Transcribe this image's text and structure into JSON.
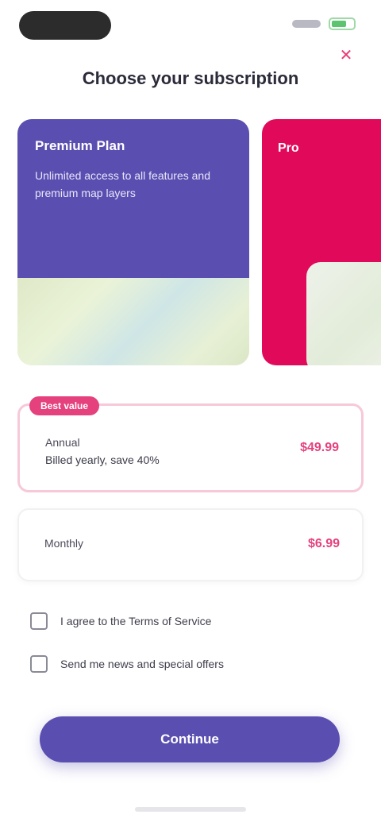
{
  "colors": {
    "primary": "#5a4fb0",
    "accent": "#e5417d",
    "pink_card": "#e1095a"
  },
  "icons": {
    "close": "close-icon",
    "signal": "signal-icon",
    "battery": "battery-icon"
  },
  "header": {
    "title": "Choose your subscription",
    "close_symbol": "✕"
  },
  "carousel": {
    "cards": [
      {
        "title": "Premium Plan",
        "description": "Unlimited access to all features and premium map layers"
      },
      {
        "title": "Pro"
      }
    ]
  },
  "options": [
    {
      "badge": "Best value",
      "label": "Annual",
      "sub": "Billed yearly, save 40%",
      "price": "$49.99"
    },
    {
      "label": "Monthly",
      "price": "$6.99"
    }
  ],
  "checkboxes": [
    "I agree to the Terms of Service",
    "Send me news and special offers"
  ],
  "cta": {
    "label": "Continue"
  }
}
